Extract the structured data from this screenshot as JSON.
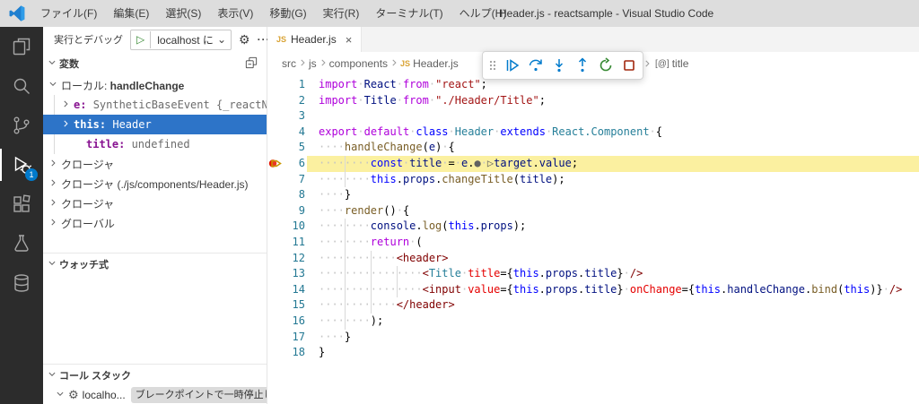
{
  "title_bar": {
    "menus": [
      "ファイル(F)",
      "編集(E)",
      "選択(S)",
      "表示(V)",
      "移動(G)",
      "実行(R)",
      "ターミナル(T)",
      "ヘルプ(H)"
    ],
    "title": "Header.js - reactsample - Visual Studio Code"
  },
  "activity_bar": {
    "icons": [
      "explorer",
      "search",
      "source-control",
      "run-and-debug",
      "extensions",
      "testing",
      "database"
    ],
    "active": "run-and-debug",
    "debug_badge": "1"
  },
  "sidebar": {
    "header": {
      "label": "実行とデバッグ",
      "launch_config": "localhost に",
      "icons": [
        "play",
        "chevron-down",
        "gear",
        "more-actions"
      ]
    },
    "sections": {
      "variables": "変数",
      "watch": "ウォッチ式",
      "call_stack": "コール スタック"
    },
    "variables_rows": [
      {
        "lvl": 0,
        "tw": "open",
        "mono": false,
        "sel": false,
        "segs": [
          [
            "scope",
            "ローカル: "
          ],
          [
            "scopeb",
            "handleChange"
          ]
        ]
      },
      {
        "lvl": 1,
        "tw": "closed",
        "mono": true,
        "sel": false,
        "segs": [
          [
            "vname",
            "e: "
          ],
          [
            "vval",
            "SyntheticBaseEvent {_reactNa…"
          ]
        ]
      },
      {
        "lvl": 1,
        "tw": "closed",
        "mono": true,
        "sel": true,
        "segs": [
          [
            "vname",
            "this: "
          ],
          [
            "vval",
            "Header"
          ]
        ]
      },
      {
        "lvl": 2,
        "tw": "none",
        "mono": true,
        "sel": false,
        "segs": [
          [
            "vname",
            "title: "
          ],
          [
            "vval",
            "undefined"
          ]
        ]
      },
      {
        "lvl": 0,
        "tw": "closed",
        "mono": false,
        "sel": false,
        "segs": [
          [
            "scope",
            "クロージャ"
          ]
        ]
      },
      {
        "lvl": 0,
        "tw": "closed",
        "mono": false,
        "sel": false,
        "segs": [
          [
            "scope",
            "クロージャ (./js/components/Header.js)"
          ]
        ]
      },
      {
        "lvl": 0,
        "tw": "closed",
        "mono": false,
        "sel": false,
        "segs": [
          [
            "scope",
            "クロージャ"
          ]
        ]
      },
      {
        "lvl": 0,
        "tw": "closed",
        "mono": false,
        "sel": false,
        "segs": [
          [
            "scope",
            "グローバル"
          ]
        ]
      }
    ],
    "call_stack": {
      "thread": "localho...",
      "paused_badge": "ブレークポイントで一時停止しました"
    }
  },
  "editor": {
    "tab": {
      "label": "Header.js",
      "file_icon": "JS"
    },
    "breadcrumb_items": [
      "src",
      "js",
      "components",
      "Header.js"
    ],
    "breadcrumb_tail": {
      "label": "title",
      "icon": "symbol-property"
    },
    "debug_toolbar": [
      "continue",
      "step-over",
      "step-into",
      "step-out",
      "restart",
      "stop"
    ],
    "code_lines": [
      {
        "n": 1,
        "tokens": [
          [
            "kw1",
            "import"
          ],
          [
            "ws",
            " "
          ],
          [
            "var",
            "React"
          ],
          [
            "ws",
            " "
          ],
          [
            "kw1",
            "from"
          ],
          [
            "ws",
            " "
          ],
          [
            "str",
            "\"react\""
          ],
          [
            "pun",
            ";"
          ]
        ]
      },
      {
        "n": 2,
        "tokens": [
          [
            "kw1",
            "import"
          ],
          [
            "ws",
            " "
          ],
          [
            "var",
            "Title"
          ],
          [
            "ws",
            " "
          ],
          [
            "kw1",
            "from"
          ],
          [
            "ws",
            " "
          ],
          [
            "str",
            "\"./Header/Title\""
          ],
          [
            "pun",
            ";"
          ]
        ]
      },
      {
        "n": 3,
        "tokens": []
      },
      {
        "n": 4,
        "tokens": [
          [
            "kw1",
            "export"
          ],
          [
            "ws",
            " "
          ],
          [
            "kw1",
            "default"
          ],
          [
            "ws",
            " "
          ],
          [
            "kw2",
            "class"
          ],
          [
            "ws",
            " "
          ],
          [
            "type",
            "Header"
          ],
          [
            "ws",
            " "
          ],
          [
            "kw2",
            "extends"
          ],
          [
            "ws",
            " "
          ],
          [
            "type",
            "React.Component"
          ],
          [
            "ws",
            " "
          ],
          [
            "pun",
            "{"
          ]
        ]
      },
      {
        "n": 5,
        "tokens": [
          [
            "ws",
            "    "
          ],
          [
            "fn",
            "handleChange"
          ],
          [
            "pun",
            "("
          ],
          [
            "var",
            "e"
          ],
          [
            "pun",
            ")"
          ],
          [
            "ws",
            " "
          ],
          [
            "pun",
            "{"
          ]
        ]
      },
      {
        "n": 6,
        "hl": true,
        "bp": true,
        "tokens": [
          [
            "ws",
            "        "
          ],
          [
            "kw2",
            "const"
          ],
          [
            "ws",
            " "
          ],
          [
            "var",
            "title"
          ],
          [
            "ws",
            " "
          ],
          [
            "pun",
            "="
          ],
          [
            "ws",
            " "
          ],
          [
            "var",
            "e"
          ],
          [
            "pun",
            "."
          ],
          [
            "mdot",
            "●"
          ],
          [
            "ws",
            " "
          ],
          [
            "mplay",
            "▷"
          ],
          [
            "var",
            "target"
          ],
          [
            "pun",
            "."
          ],
          [
            "var",
            "value"
          ],
          [
            "pun",
            ";"
          ]
        ]
      },
      {
        "n": 7,
        "tokens": [
          [
            "ws",
            "        "
          ],
          [
            "kw2",
            "this"
          ],
          [
            "pun",
            "."
          ],
          [
            "var",
            "props"
          ],
          [
            "pun",
            "."
          ],
          [
            "fn",
            "changeTitle"
          ],
          [
            "pun",
            "("
          ],
          [
            "var",
            "title"
          ],
          [
            "pun",
            ");"
          ]
        ]
      },
      {
        "n": 8,
        "tokens": [
          [
            "ws",
            "    "
          ],
          [
            "pun",
            "}"
          ]
        ]
      },
      {
        "n": 9,
        "tokens": [
          [
            "ws",
            "    "
          ],
          [
            "fn",
            "render"
          ],
          [
            "pun",
            "()"
          ],
          [
            "ws",
            " "
          ],
          [
            "pun",
            "{"
          ]
        ]
      },
      {
        "n": 10,
        "tokens": [
          [
            "ws",
            "        "
          ],
          [
            "var",
            "console"
          ],
          [
            "pun",
            "."
          ],
          [
            "fn",
            "log"
          ],
          [
            "pun",
            "("
          ],
          [
            "kw2",
            "this"
          ],
          [
            "pun",
            "."
          ],
          [
            "var",
            "props"
          ],
          [
            "pun",
            ");"
          ]
        ]
      },
      {
        "n": 11,
        "tokens": [
          [
            "ws",
            "        "
          ],
          [
            "kw1",
            "return"
          ],
          [
            "ws",
            " "
          ],
          [
            "pun",
            "("
          ]
        ]
      },
      {
        "n": 12,
        "tokens": [
          [
            "ws",
            "            "
          ],
          [
            "tag",
            "<header>"
          ]
        ]
      },
      {
        "n": 13,
        "tokens": [
          [
            "ws",
            "                "
          ],
          [
            "tag",
            "<"
          ],
          [
            "type",
            "Title"
          ],
          [
            "ws",
            " "
          ],
          [
            "attr",
            "title"
          ],
          [
            "pun",
            "={"
          ],
          [
            "kw2",
            "this"
          ],
          [
            "pun",
            "."
          ],
          [
            "var",
            "props"
          ],
          [
            "pun",
            "."
          ],
          [
            "var",
            "title"
          ],
          [
            "pun",
            "}"
          ],
          [
            "ws",
            " "
          ],
          [
            "tag",
            "/>"
          ]
        ]
      },
      {
        "n": 14,
        "tokens": [
          [
            "ws",
            "                "
          ],
          [
            "tag",
            "<input"
          ],
          [
            "ws",
            " "
          ],
          [
            "attr",
            "value"
          ],
          [
            "pun",
            "={"
          ],
          [
            "kw2",
            "this"
          ],
          [
            "pun",
            "."
          ],
          [
            "var",
            "props"
          ],
          [
            "pun",
            "."
          ],
          [
            "var",
            "title"
          ],
          [
            "pun",
            "}"
          ],
          [
            "ws",
            " "
          ],
          [
            "attr",
            "onChange"
          ],
          [
            "pun",
            "={"
          ],
          [
            "kw2",
            "this"
          ],
          [
            "pun",
            "."
          ],
          [
            "var",
            "handleChange"
          ],
          [
            "pun",
            "."
          ],
          [
            "fn",
            "bind"
          ],
          [
            "pun",
            "("
          ],
          [
            "kw2",
            "this"
          ],
          [
            "pun",
            ")}"
          ],
          [
            "ws",
            " "
          ],
          [
            "tag",
            "/>"
          ]
        ]
      },
      {
        "n": 15,
        "tokens": [
          [
            "ws",
            "            "
          ],
          [
            "tag",
            "</header>"
          ]
        ]
      },
      {
        "n": 16,
        "tokens": [
          [
            "ws",
            "        "
          ],
          [
            "pun",
            ");"
          ]
        ]
      },
      {
        "n": 17,
        "tokens": [
          [
            "ws",
            "    "
          ],
          [
            "pun",
            "}"
          ]
        ]
      },
      {
        "n": 18,
        "tokens": [
          [
            "pun",
            "}"
          ]
        ]
      }
    ]
  },
  "colors": {
    "accent_blue": "#007ACC",
    "debug_green": "#388A34",
    "debug_red": "#A1260D",
    "selection_blue": "#2D74C8",
    "current_line_highlight": "#FBF0A0",
    "breakpoint_red": "#E51400",
    "js_icon_yellow": "#D9A334",
    "titlebar_bg": "#DDDDDD",
    "activitybar_bg": "#2C2C2C"
  }
}
